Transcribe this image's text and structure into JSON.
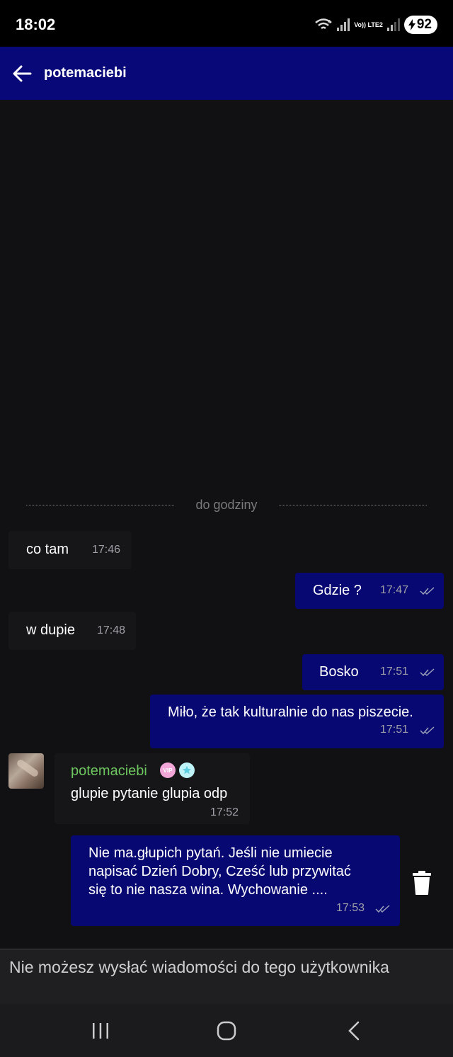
{
  "status": {
    "time": "18:02",
    "network_label": "Vo)) LTE2",
    "battery": "92",
    "icons": [
      "wifi-icon",
      "signal-icon",
      "volte-icon",
      "signal-icon",
      "battery-charging-icon"
    ]
  },
  "header": {
    "back_icon": "arrow-left-icon",
    "title": "potemaciebi"
  },
  "chat": {
    "divider_label": "do godziny",
    "messages": [
      {
        "direction": "in",
        "text": "co tam",
        "time": "17:46"
      },
      {
        "direction": "out",
        "text": "Gdzie ?",
        "time": "17:47",
        "read": true
      },
      {
        "direction": "in",
        "text": "w dupie",
        "time": "17:48"
      },
      {
        "direction": "out",
        "text": "Bosko",
        "time": "17:51",
        "read": true
      },
      {
        "direction": "out",
        "text": "Miło, że tak kulturalnie do nas piszecie.",
        "time": "17:51",
        "read": true
      },
      {
        "direction": "in",
        "sender": "potemaciebi",
        "text": "glupie pytanie glupia odp",
        "time": "17:52",
        "badges": [
          "vip-badge",
          "star-badge"
        ]
      },
      {
        "direction": "out",
        "lines": [
          "Nie ma.głupich pytań. Jeśli nie umiecie",
          "napisać Dzień Dobry, Cześć lub przywitać",
          "się to nie nasza wina. Wychowanie ...."
        ],
        "time": "17:53",
        "read": true
      }
    ],
    "vip_label": "VIP"
  },
  "footer": {
    "notice": "Nie możesz wysłać wiadomości do tego użytkownika"
  },
  "navbar": {
    "items": [
      "recent-apps-icon",
      "home-icon",
      "back-icon"
    ]
  },
  "colors": {
    "header_bg": "#080878",
    "outgoing_bubble": "#080872",
    "incoming_bubble": "#161618",
    "sender_name": "#6dc65f",
    "background": "#111113"
  }
}
